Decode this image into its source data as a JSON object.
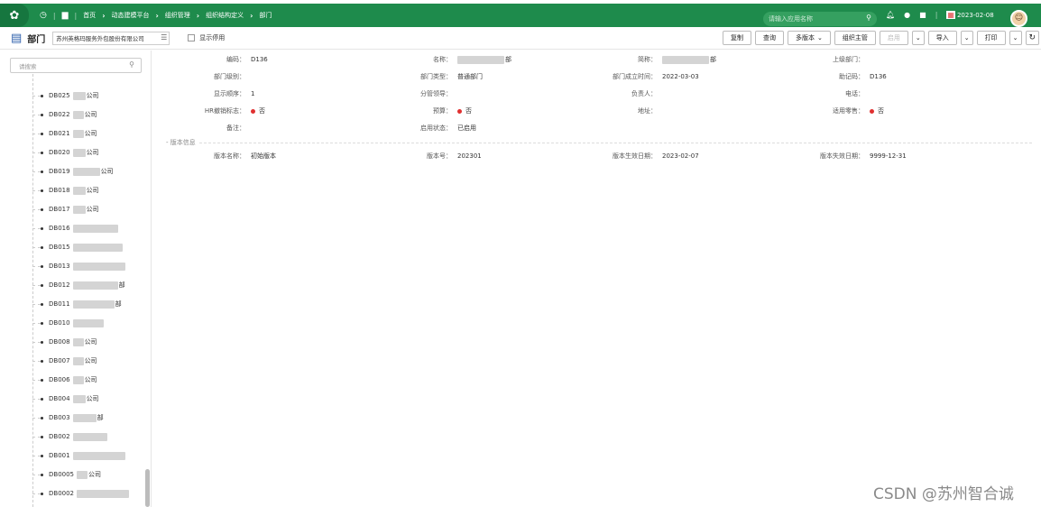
{
  "topbar": {
    "breadcrumb": [
      "首页",
      "动态建模平台",
      "组织管理",
      "组织结构定义",
      "部门"
    ],
    "search_placeholder": "请输入应用名称",
    "date": "2023-02-08"
  },
  "toolbar": {
    "title": "部门",
    "org_value": "苏州英格玛服务外包股份有限公司",
    "show_disabled_label": "显示停用",
    "buttons": {
      "copy": "复制",
      "query": "查询",
      "multiversion": "多版本",
      "org_manager": "组织主管",
      "enable": "启用",
      "import": "导入",
      "print": "打印"
    }
  },
  "sidebar": {
    "search_placeholder": "请搜索",
    "items": [
      {
        "code": "DB025",
        "suffix": "公司",
        "blur": 14
      },
      {
        "code": "DB022",
        "suffix": "公司",
        "blur": 12
      },
      {
        "code": "DB021",
        "suffix": "公司",
        "blur": 12
      },
      {
        "code": "DB020",
        "suffix": "公司",
        "blur": 14
      },
      {
        "code": "DB019",
        "suffix": "公司",
        "blur": 30
      },
      {
        "code": "DB018",
        "suffix": "公司",
        "blur": 14
      },
      {
        "code": "DB017",
        "suffix": "公司",
        "blur": 14
      },
      {
        "code": "DB016",
        "suffix": "",
        "blur": 50
      },
      {
        "code": "DB015",
        "suffix": "",
        "blur": 55
      },
      {
        "code": "DB013",
        "suffix": "",
        "blur": 58
      },
      {
        "code": "DB012",
        "suffix": "部",
        "blur": 50
      },
      {
        "code": "DB011",
        "suffix": "部",
        "blur": 46
      },
      {
        "code": "DB010",
        "suffix": "",
        "blur": 34
      },
      {
        "code": "DB008",
        "suffix": "公司",
        "blur": 12
      },
      {
        "code": "DB007",
        "suffix": "公司",
        "blur": 12
      },
      {
        "code": "DB006",
        "suffix": "公司",
        "blur": 12
      },
      {
        "code": "DB004",
        "suffix": "公司",
        "blur": 14
      },
      {
        "code": "DB003",
        "suffix": "部",
        "blur": 26
      },
      {
        "code": "DB002",
        "suffix": "",
        "blur": 38
      },
      {
        "code": "DB001",
        "suffix": "",
        "blur": 58
      },
      {
        "code": "DB0005",
        "suffix": "公司",
        "blur": 12
      },
      {
        "code": "DB0002",
        "suffix": "",
        "blur": 58
      }
    ]
  },
  "form": {
    "row1": [
      {
        "label": "编码：",
        "value": "D136"
      },
      {
        "label": "名称：",
        "value": "部"
      },
      {
        "label": "简称：",
        "value": "部"
      },
      {
        "label": "上级部门：",
        "value": ""
      }
    ],
    "row2": [
      {
        "label": "部门级别：",
        "value": ""
      },
      {
        "label": "部门类型：",
        "value": "普通部门"
      },
      {
        "label": "部门成立时间：",
        "value": "2022-03-03"
      },
      {
        "label": "助记码：",
        "value": "D136"
      }
    ],
    "row3": [
      {
        "label": "显示顺序：",
        "value": "1"
      },
      {
        "label": "分管领导：",
        "value": ""
      },
      {
        "label": "负责人：",
        "value": ""
      },
      {
        "label": "电话：",
        "value": ""
      }
    ],
    "row4": [
      {
        "label": "HR撤销标志：",
        "value": "否",
        "dot": true
      },
      {
        "label": "预算：",
        "value": "否",
        "dot": true
      },
      {
        "label": "地址：",
        "value": ""
      },
      {
        "label": "适用零售：",
        "value": "否",
        "dot": true
      }
    ],
    "row5": [
      {
        "label": "备注：",
        "value": ""
      },
      {
        "label": "启用状态：",
        "value": "已启用"
      }
    ],
    "section_title": "版本信息",
    "row6": [
      {
        "label": "版本名称：",
        "value": "初始版本"
      },
      {
        "label": "版本号：",
        "value": "202301"
      },
      {
        "label": "版本生效日期：",
        "value": "2023-02-07"
      },
      {
        "label": "版本失效日期：",
        "value": "9999-12-31"
      }
    ]
  },
  "watermark": "CSDN @苏州智合诚",
  "colors": {
    "header_green": "#1e8b4c",
    "required_red": "#e03030"
  }
}
